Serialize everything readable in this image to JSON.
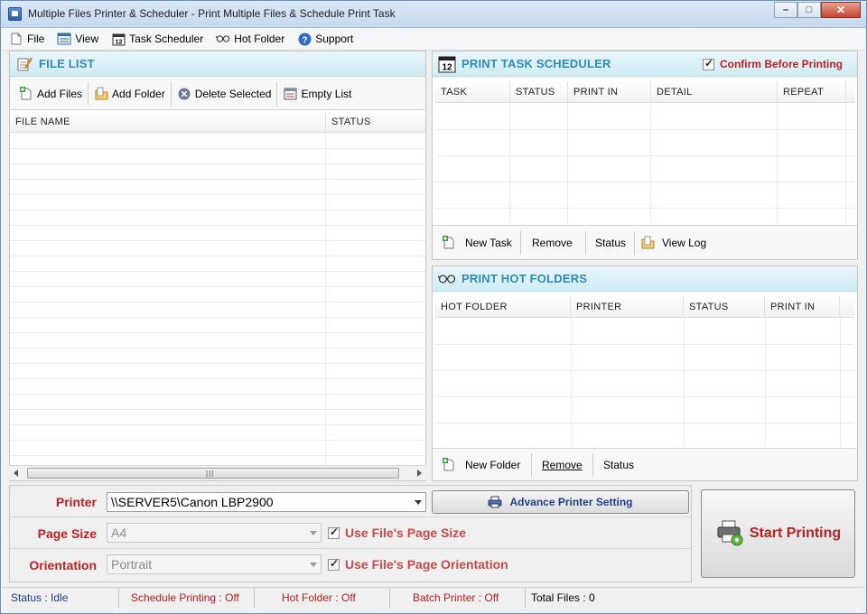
{
  "window": {
    "title": "Multiple Files Printer & Scheduler - Print Multiple Files & Schedule Print Task",
    "minimize": "–",
    "maximize": "□",
    "close": "✕"
  },
  "menu": {
    "items": [
      {
        "label": "File",
        "icon": "file-icon"
      },
      {
        "label": "View",
        "icon": "view-icon"
      },
      {
        "label": "Task Scheduler",
        "icon": "calendar-icon"
      },
      {
        "label": "Hot Folder",
        "icon": "glasses-icon"
      },
      {
        "label": "Support",
        "icon": "help-icon"
      }
    ]
  },
  "file_list": {
    "title": "FILE LIST",
    "toolbar": {
      "add_files": "Add Files",
      "add_folder": "Add Folder",
      "delete_selected": "Delete Selected",
      "empty_list": "Empty List"
    },
    "columns": [
      "FILE NAME",
      "STATUS"
    ],
    "rows": []
  },
  "scheduler": {
    "title": "PRINT TASK SCHEDULER",
    "confirm_label": "Confirm Before Printing",
    "confirm_checked": true,
    "columns": [
      "TASK",
      "STATUS",
      "PRINT IN",
      "DETAIL",
      "REPEAT"
    ],
    "rows": [],
    "toolbar": {
      "new_task": "New Task",
      "remove": "Remove",
      "status": "Status",
      "view_log": "View Log"
    }
  },
  "hot_folders": {
    "title": "PRINT HOT FOLDERS",
    "columns": [
      "HOT FOLDER",
      "PRINTER",
      "STATUS",
      "PRINT IN"
    ],
    "rows": [],
    "toolbar": {
      "new_folder": "New Folder",
      "remove": "Remove",
      "status": "Status"
    }
  },
  "settings": {
    "printer_label": "Printer",
    "printer_value": "\\\\SERVER5\\Canon LBP2900",
    "page_size_label": "Page Size",
    "page_size_value": "A4",
    "use_page_size_label": "Use File's Page Size",
    "use_page_size_checked": true,
    "orientation_label": "Orientation",
    "orientation_value": "Portrait",
    "use_orientation_label": "Use File's Page Orientation",
    "use_orientation_checked": true,
    "advance_printer_setting": "Advance Printer Setting",
    "start_printing": "Start Printing"
  },
  "status_bar": {
    "status": "Status :  Idle",
    "schedule": "Schedule Printing : Off",
    "hot_folder": "Hot Folder : Off",
    "batch": "Batch Printer : Off",
    "total_files": "Total Files :   0"
  },
  "colors": {
    "header_text": "#2f8cb5",
    "label_red": "#c02020",
    "status_blue": "#1a3b8a"
  }
}
